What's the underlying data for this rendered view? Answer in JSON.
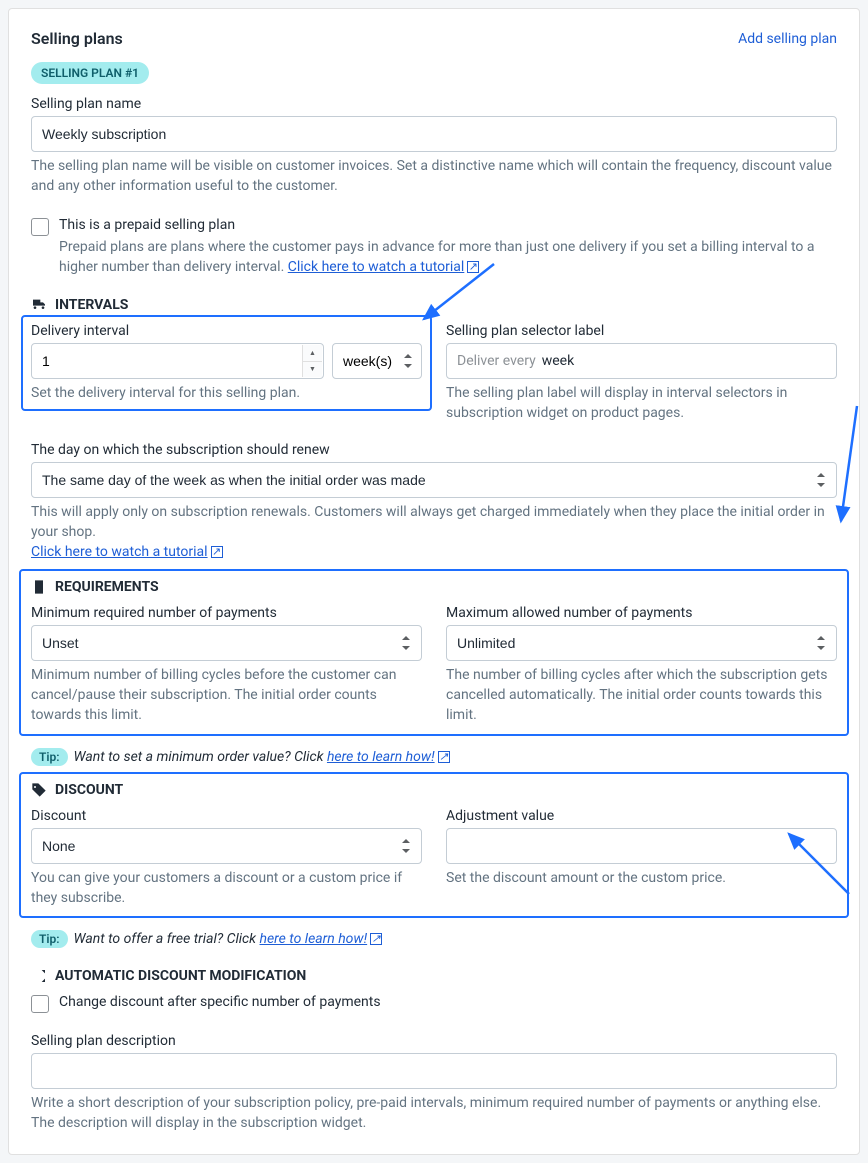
{
  "header": {
    "title": "Selling plans",
    "add_link": "Add selling plan"
  },
  "badge": "SELLING PLAN #1",
  "name_field": {
    "label": "Selling plan name",
    "value": "Weekly subscription",
    "helper": "The selling plan name will be visible on customer invoices. Set a distinctive name which will contain the frequency, discount value and any other information useful to the customer."
  },
  "prepaid": {
    "label": "This is a prepaid selling plan",
    "helper_before": "Prepaid plans are plans where the customer pays in advance for more than just one delivery if you set a billing interval to a higher number than delivery interval. ",
    "tutorial_link": "Click here to watch a tutorial"
  },
  "intervals": {
    "title": "INTERVALS",
    "delivery": {
      "label": "Delivery interval",
      "value": "1",
      "unit": "week(s)",
      "helper": "Set the delivery interval for this selling plan."
    },
    "selector": {
      "label": "Selling plan selector label",
      "placeholder": "Deliver every",
      "value": "week",
      "helper": "The selling plan label will display in interval selectors in subscription widget on product pages."
    },
    "renew": {
      "label": "The day on which the subscription should renew",
      "value": "The same day of the week as when the initial order was made",
      "helper_before": "This will apply only on subscription renewals. Customers will always get charged immediately when they place the initial order in your shop. ",
      "tutorial_link": "Click here to watch a tutorial"
    }
  },
  "requirements": {
    "title": "REQUIREMENTS",
    "min": {
      "label": "Minimum required number of payments",
      "value": "Unset",
      "helper": "Minimum number of billing cycles before the customer can cancel/pause their subscription. The initial order counts towards this limit."
    },
    "max": {
      "label": "Maximum allowed number of payments",
      "value": "Unlimited",
      "helper": "The number of billing cycles after which the subscription gets cancelled automatically. The initial order counts towards this limit."
    }
  },
  "tip1": {
    "badge": "Tip:",
    "text_before": "Want to set a minimum order value? Click ",
    "link": "here to learn how!"
  },
  "discount": {
    "title": "DISCOUNT",
    "type": {
      "label": "Discount",
      "value": "None",
      "helper": "You can give your customers a discount or a custom price if they subscribe."
    },
    "adjustment": {
      "label": "Adjustment value",
      "value": "",
      "helper": "Set the discount amount or the custom price."
    }
  },
  "tip2": {
    "badge": "Tip:",
    "text_before": "Want to offer a free trial? Click ",
    "link": "here to learn how!"
  },
  "auto_mod": {
    "title": "AUTOMATIC DISCOUNT MODIFICATION",
    "check_label": "Change discount after specific number of payments"
  },
  "description": {
    "label": "Selling plan description",
    "value": "",
    "helper": "Write a short description of your subscription policy, pre-paid intervals, minimum required number of payments or anything else. The description will display in the subscription widget."
  }
}
